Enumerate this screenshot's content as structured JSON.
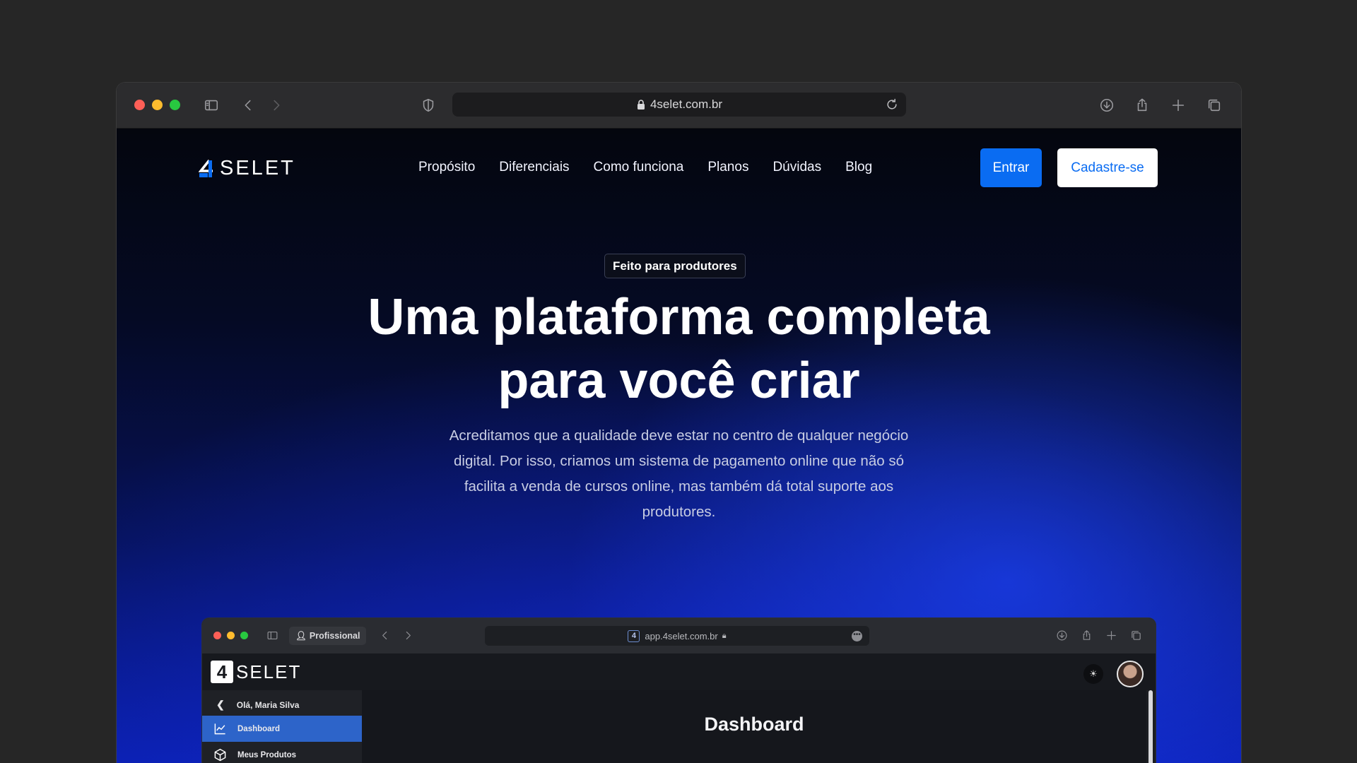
{
  "browser": {
    "url": "4selet.com.br"
  },
  "site": {
    "logo_text": "SELET",
    "nav": [
      "Propósito",
      "Diferenciais",
      "Como funciona",
      "Planos",
      "Dúvidas",
      "Blog"
    ],
    "login_label": "Entrar",
    "signup_label": "Cadastre-se",
    "badge": "Feito para produtores",
    "title_line1_a": "Uma plataforma ",
    "title_line1_highlight": "completa",
    "title_line2": "para você criar",
    "subtitle": "Acreditamos que a qualidade deve estar no centro de qualquer negócio digital. Por isso, criamos um sistema de pagamento online que não só facilita a venda de cursos online, mas também dá total suporte aos produtores.",
    "colors": {
      "accent": "#0a6cf2"
    }
  },
  "preview": {
    "profile_label": "Profissional",
    "url": "app.4selet.com.br",
    "logo_text": "SELET",
    "greeting": "Olá, Maria Silva",
    "sidebar_items": [
      "Dashboard",
      "Meus Produtos"
    ],
    "page_title": "Dashboard"
  }
}
